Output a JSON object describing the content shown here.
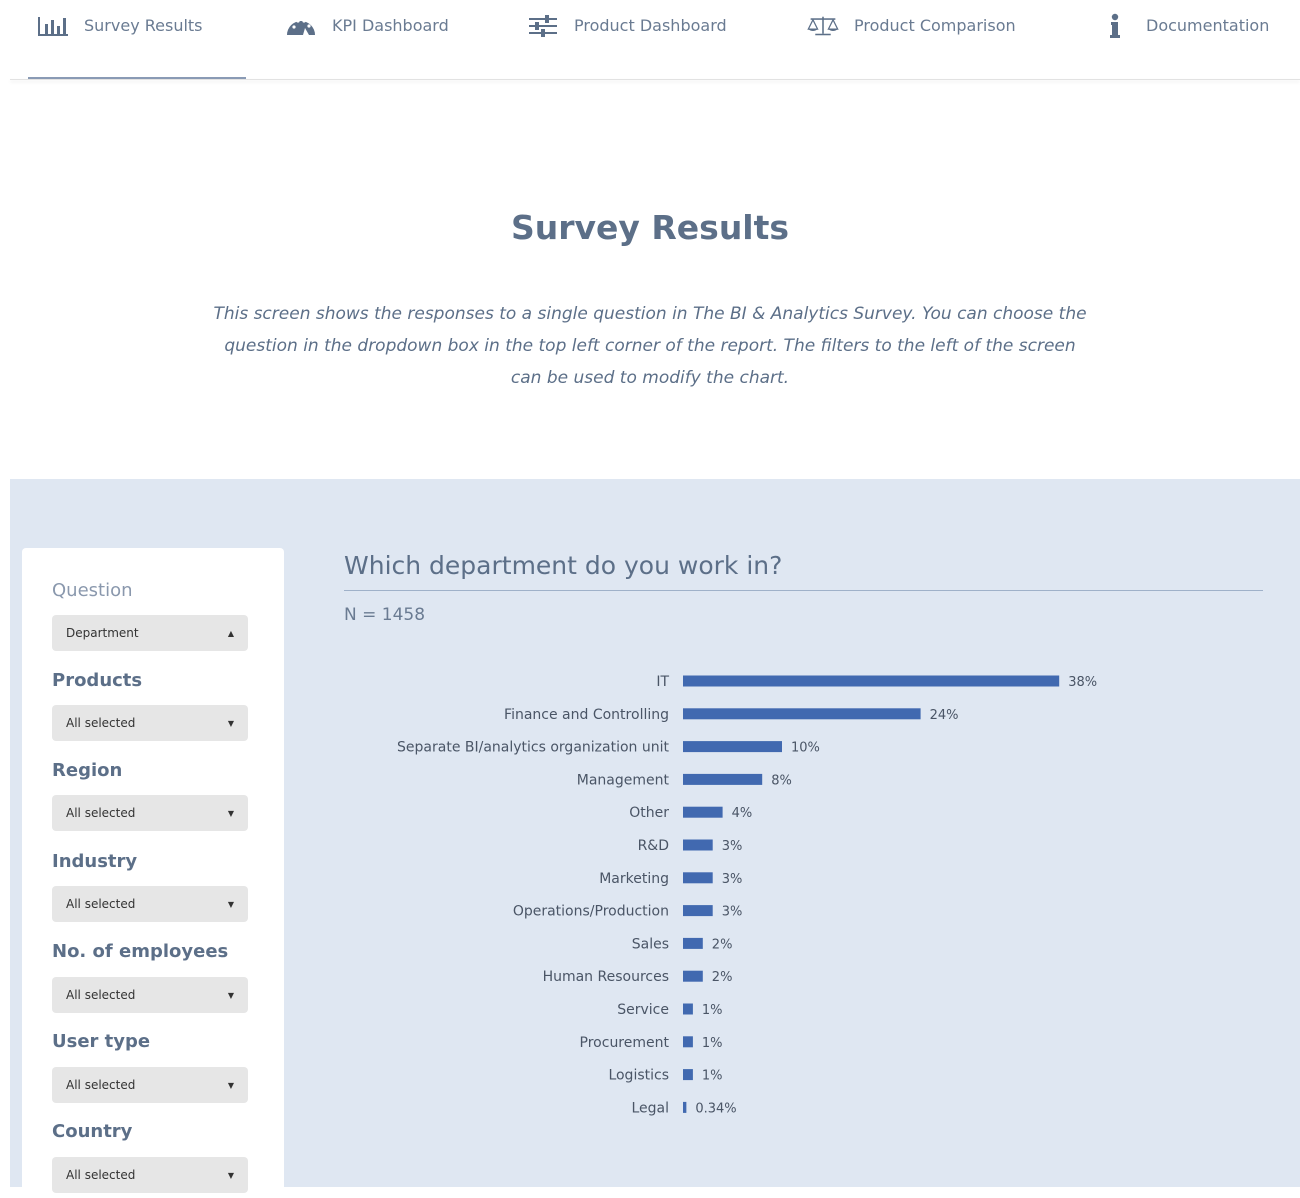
{
  "nav": {
    "items": [
      {
        "label": "Survey Results",
        "icon": "bar-chart-icon",
        "active": true
      },
      {
        "label": "KPI Dashboard",
        "icon": "speedometer-icon",
        "active": false
      },
      {
        "label": "Product Dashboard",
        "icon": "sliders-icon",
        "active": false
      },
      {
        "label": "Product Comparison",
        "icon": "balance-scale-icon",
        "active": false
      },
      {
        "label": "Documentation",
        "icon": "info-icon",
        "active": false
      }
    ]
  },
  "hero": {
    "title": "Survey Results",
    "description": "This screen shows the responses to a single question in The BI & Analytics Survey. You can choose the question in the dropdown box in the top left corner of the report. The filters to the left of the screen can be used to modify the chart."
  },
  "filters": {
    "question": {
      "label": "Question",
      "value": "Department"
    },
    "products": {
      "label": "Products",
      "value": "All selected"
    },
    "region": {
      "label": "Region",
      "value": "All selected"
    },
    "industry": {
      "label": "Industry",
      "value": "All selected"
    },
    "employees": {
      "label": "No. of employees",
      "value": "All selected"
    },
    "user_type": {
      "label": "User type",
      "value": "All selected"
    },
    "country": {
      "label": "Country",
      "value": "All selected"
    }
  },
  "report": {
    "title": "Which department do you work in?",
    "n_label": "N = 1458"
  },
  "colors": {
    "bar": "#4169b0",
    "accent": "#5c6f88",
    "panel_bg": "#dfe7f2"
  },
  "chart_data": {
    "type": "bar",
    "orientation": "horizontal",
    "categories": [
      "IT",
      "Finance and Controlling",
      "Separate BI/analytics organization unit",
      "Management",
      "Other",
      "R&D",
      "Marketing",
      "Operations/Production",
      "Sales",
      "Human Resources",
      "Service",
      "Procurement",
      "Logistics",
      "Legal"
    ],
    "values": [
      38,
      24,
      10,
      8,
      4,
      3,
      3,
      3,
      2,
      2,
      1,
      1,
      1,
      0.34
    ],
    "labels": [
      "38%",
      "24%",
      "10%",
      "8%",
      "4%",
      "3%",
      "3%",
      "3%",
      "2%",
      "2%",
      "1%",
      "1%",
      "1%",
      "0.34%"
    ]
  }
}
